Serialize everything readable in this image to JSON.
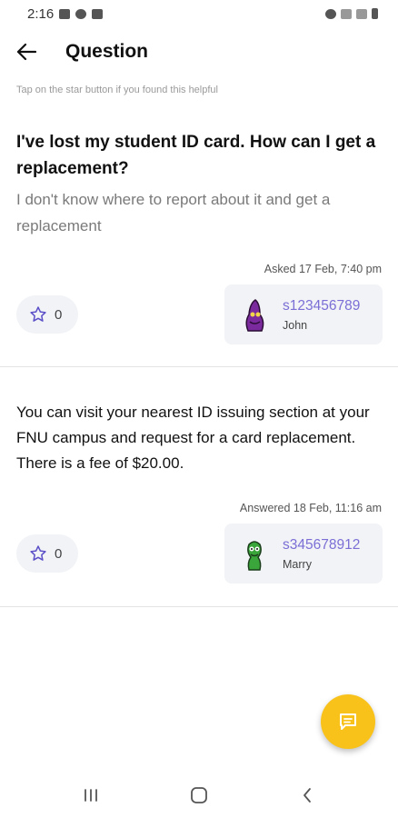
{
  "status_bar": {
    "time": "2:16"
  },
  "app_bar": {
    "title": "Question"
  },
  "hint": "Tap on the star button if you found this helpful",
  "question": {
    "title": "I've lost my student ID card. How can I get a replacement?",
    "body": "I don't know where to report about it and get a replacement",
    "meta": "Asked 17 Feb, 7:40 pm",
    "stars": "0",
    "user": {
      "id": "s123456789",
      "name": "John"
    }
  },
  "answer": {
    "body": "You can visit your nearest ID issuing section at your FNU campus and request for a card replacement. There is a fee of $20.00.",
    "meta": "Answered 18 Feb, 11:16 am",
    "stars": "0",
    "user": {
      "id": "s345678912",
      "name": "Marry"
    }
  },
  "colors": {
    "accent": "#7b6fd6",
    "fab": "#f8c21b",
    "pill_bg": "#f1f3f7"
  }
}
